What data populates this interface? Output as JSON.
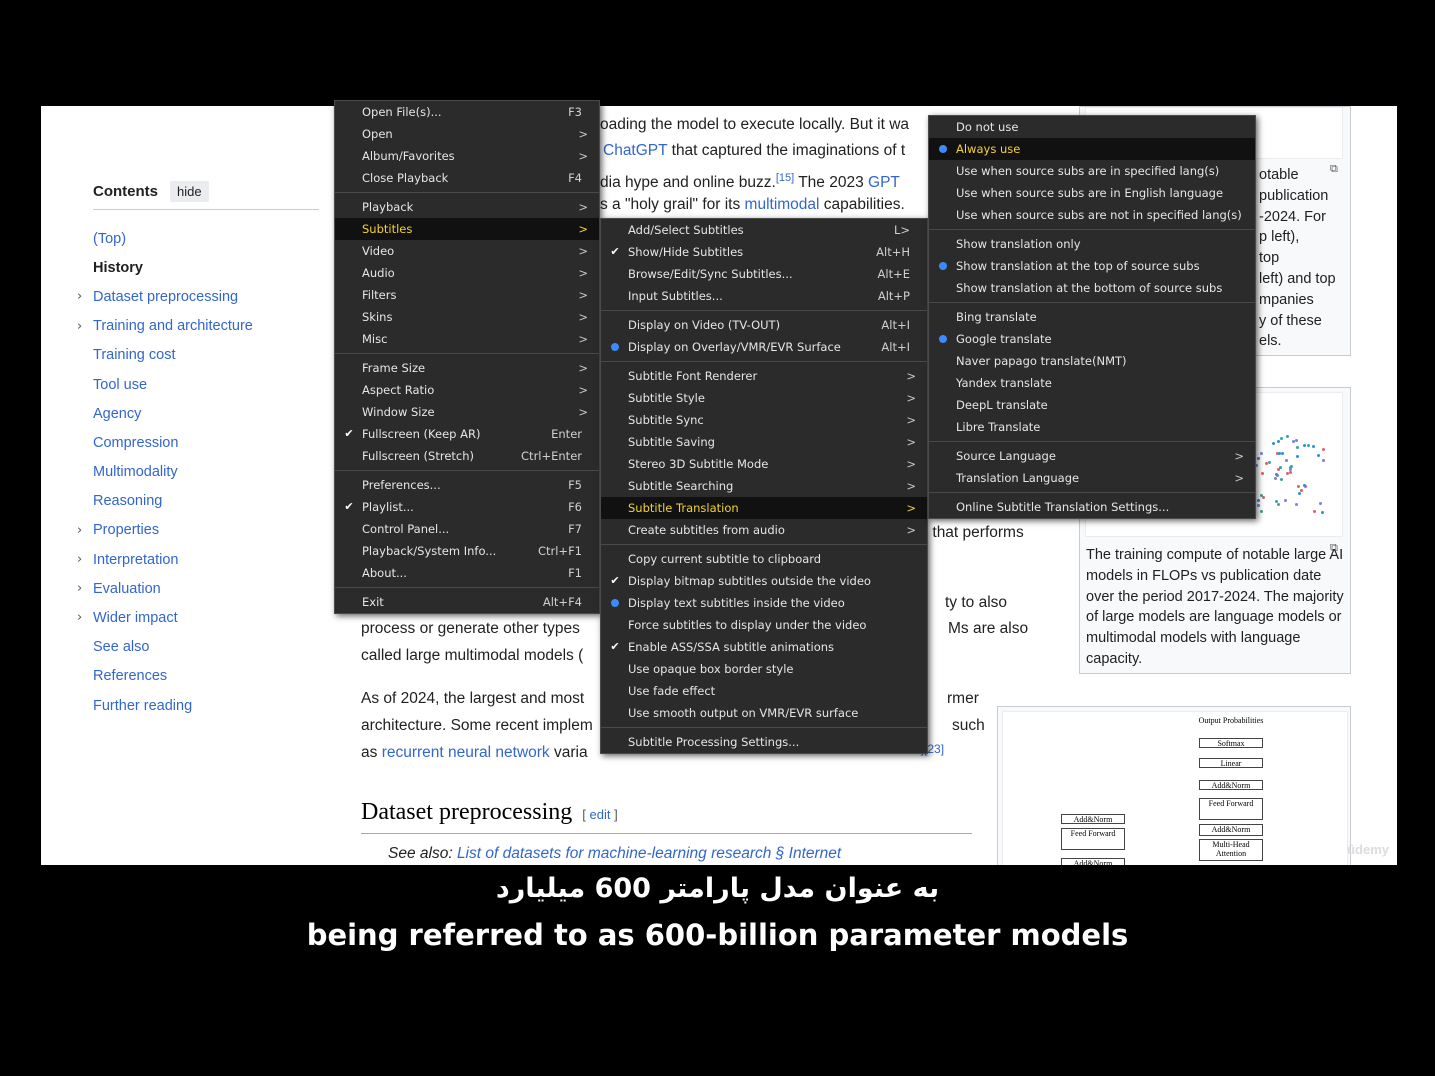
{
  "toc": {
    "title": "Contents",
    "hide": "hide",
    "items": [
      {
        "label": "(Top)",
        "chev": false,
        "bold": false
      },
      {
        "label": "History",
        "chev": false,
        "bold": true
      },
      {
        "label": "Dataset preprocessing",
        "chev": true,
        "bold": false
      },
      {
        "label": "Training and architecture",
        "chev": true,
        "bold": false
      },
      {
        "label": "Training cost",
        "chev": false,
        "bold": false
      },
      {
        "label": "Tool use",
        "chev": false,
        "bold": false
      },
      {
        "label": "Agency",
        "chev": false,
        "bold": false
      },
      {
        "label": "Compression",
        "chev": false,
        "bold": false
      },
      {
        "label": "Multimodality",
        "chev": false,
        "bold": false
      },
      {
        "label": "Reasoning",
        "chev": false,
        "bold": false
      },
      {
        "label": "Properties",
        "chev": true,
        "bold": false
      },
      {
        "label": "Interpretation",
        "chev": true,
        "bold": false
      },
      {
        "label": "Evaluation",
        "chev": true,
        "bold": false
      },
      {
        "label": "Wider impact",
        "chev": true,
        "bold": false
      },
      {
        "label": "See also",
        "chev": false,
        "bold": false
      },
      {
        "label": "References",
        "chev": false,
        "bold": false
      },
      {
        "label": "Further reading",
        "chev": false,
        "bold": false
      }
    ]
  },
  "article": {
    "l1": "oading the model to execute locally. But it wa",
    "l2_link": "ChatGPT",
    "l2_rest": " that captured the imaginations of t",
    "l3_a": "dia hype and online buzz.",
    "l3_ref": "[15]",
    "l3_b": " The 2023 ",
    "l3_link": "GPT",
    "l4_a": "s a \"holy grail\" for its ",
    "l4_link": "multimodal",
    "l4_b": " capabilities.",
    "l5_red": "el",
    "l5_rest": " that performs",
    "l6": "ty to also",
    "l7_a": "process or generate other types",
    "l7_b": "Ms are also",
    "l8": "called large multimodal models (",
    "l9_a": "As of 2024, the largest and most",
    "l9_b": "rmer",
    "l10_a": "architecture. Some recent implem",
    "l10_b": "such",
    "l11_a": "as ",
    "l11_link": "recurrent neural network",
    "l11_b": " varia",
    "l11_ref": "2][23]",
    "heading": "Dataset preprocessing",
    "edit": "edit",
    "seealso_label": "See also: ",
    "seealso_link": "List of datasets for machine-learning research § Internet"
  },
  "figure1": {
    "caption_lines": [
      "otable",
      "publication",
      "-2024. For",
      "p left),",
      "top",
      "left) and top",
      "mpanies",
      "y of these",
      "els."
    ]
  },
  "figure2": {
    "caption": "The training compute of notable large AI models in FLOPs vs publication date over the period 2017-2024. The majority of large models are language models or multimodal models with language capacity."
  },
  "figure3": {
    "blocks": [
      "Output Probabilities",
      "Softmax",
      "Linear",
      "Add&Norm",
      "Feed Forward",
      "Add&Norm",
      "Multi-Head Attention",
      "Add&Norm",
      "Feed Forward",
      "Add&Norm"
    ]
  },
  "watermark": "ûdemy",
  "subtitles": {
    "fa": "به عنوان مدل پارامتر 600 میلیارد",
    "en": "being referred to as 600-billion parameter models"
  },
  "menu_main": {
    "items": [
      {
        "label": "Open File(s)...",
        "shortcut": "F3"
      },
      {
        "label": "Open",
        "arrow": true
      },
      {
        "label": "Album/Favorites",
        "arrow": true
      },
      {
        "label": "Close Playback",
        "shortcut": "F4"
      },
      {
        "sep": true
      },
      {
        "label": "Playback",
        "arrow": true
      },
      {
        "label": "Subtitles",
        "arrow": true,
        "highlight": true
      },
      {
        "label": "Video",
        "arrow": true
      },
      {
        "label": "Audio",
        "arrow": true
      },
      {
        "label": "Filters",
        "arrow": true
      },
      {
        "label": "Skins",
        "arrow": true
      },
      {
        "label": "Misc",
        "arrow": true
      },
      {
        "sep": true
      },
      {
        "label": "Frame Size",
        "arrow": true
      },
      {
        "label": "Aspect Ratio",
        "arrow": true
      },
      {
        "label": "Window Size",
        "arrow": true
      },
      {
        "label": "Fullscreen (Keep AR)",
        "shortcut": "Enter",
        "check": true
      },
      {
        "label": "Fullscreen (Stretch)",
        "shortcut": "Ctrl+Enter"
      },
      {
        "sep": true
      },
      {
        "label": "Preferences...",
        "shortcut": "F5"
      },
      {
        "label": "Playlist...",
        "shortcut": "F6",
        "check": true
      },
      {
        "label": "Control Panel...",
        "shortcut": "F7"
      },
      {
        "label": "Playback/System Info...",
        "shortcut": "Ctrl+F1"
      },
      {
        "label": "About...",
        "shortcut": "F1"
      },
      {
        "sep": true
      },
      {
        "label": "Exit",
        "shortcut": "Alt+F4"
      }
    ]
  },
  "menu_subtitles": {
    "items": [
      {
        "label": "Add/Select Subtitles",
        "shortcut": "L>"
      },
      {
        "label": "Show/Hide Subtitles",
        "shortcut": "Alt+H",
        "check": true
      },
      {
        "label": "Browse/Edit/Sync Subtitles...",
        "shortcut": "Alt+E"
      },
      {
        "label": "Input Subtitles...",
        "shortcut": "Alt+P"
      },
      {
        "sep": true
      },
      {
        "label": "Display on Video (TV-OUT)",
        "shortcut": "Alt+I"
      },
      {
        "label": "Display on Overlay/VMR/EVR Surface",
        "shortcut": "Alt+I",
        "radio": true
      },
      {
        "sep": true
      },
      {
        "label": "Subtitle Font Renderer",
        "arrow": true
      },
      {
        "label": "Subtitle Style",
        "arrow": true
      },
      {
        "label": "Subtitle Sync",
        "arrow": true
      },
      {
        "label": "Subtitle Saving",
        "arrow": true
      },
      {
        "label": "Stereo 3D Subtitle Mode",
        "arrow": true
      },
      {
        "label": "Subtitle Searching",
        "arrow": true
      },
      {
        "label": "Subtitle Translation",
        "arrow": true,
        "highlight": true
      },
      {
        "label": "Create subtitles from audio",
        "arrow": true
      },
      {
        "sep": true
      },
      {
        "label": "Copy current subtitle to clipboard"
      },
      {
        "label": "Display bitmap subtitles outside the video",
        "check": true
      },
      {
        "label": "Display text subtitles inside the video",
        "radio": true
      },
      {
        "label": "Force subtitles to display under the video"
      },
      {
        "label": "Enable ASS/SSA subtitle animations",
        "check": true
      },
      {
        "label": "Use opaque box border style"
      },
      {
        "label": "Use fade effect"
      },
      {
        "label": "Use smooth output on VMR/EVR surface"
      },
      {
        "sep": true
      },
      {
        "label": "Subtitle Processing Settings..."
      }
    ]
  },
  "menu_translation": {
    "items": [
      {
        "label": "Do not use"
      },
      {
        "label": "Always use",
        "radio": true,
        "highlight": true
      },
      {
        "label": "Use when source subs are in specified lang(s)"
      },
      {
        "label": "Use when source subs are in English language"
      },
      {
        "label": "Use when source subs are not in specified lang(s)"
      },
      {
        "sep": true
      },
      {
        "label": "Show translation only"
      },
      {
        "label": "Show translation at the top of source subs",
        "radio": true
      },
      {
        "label": "Show translation at the bottom of source subs"
      },
      {
        "sep": true
      },
      {
        "label": "Bing translate"
      },
      {
        "label": "Google translate",
        "radio": true
      },
      {
        "label": "Naver papago translate(NMT)"
      },
      {
        "label": "Yandex translate"
      },
      {
        "label": "DeepL translate"
      },
      {
        "label": "Libre Translate"
      },
      {
        "sep": true
      },
      {
        "label": "Source Language",
        "arrow": true
      },
      {
        "label": "Translation Language",
        "arrow": true
      },
      {
        "sep": true
      },
      {
        "label": "Online Subtitle Translation Settings..."
      }
    ]
  },
  "icons": {
    "check": "check-icon",
    "radio": "radio-dot-icon",
    "arrow": "chevron-right-icon"
  },
  "colors": {
    "highlight_text": "#f2d331",
    "radio": "#3b8bff",
    "menu_bg": "#2b2b2b",
    "link": "#3366cc"
  }
}
